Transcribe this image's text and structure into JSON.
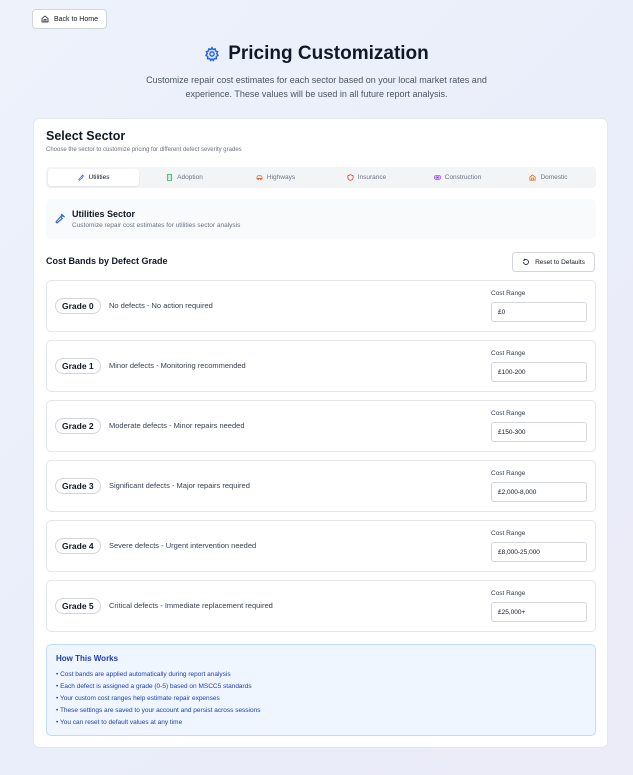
{
  "nav": {
    "back_label": "Back to Home"
  },
  "header": {
    "title": "Pricing Customization",
    "subtitle": "Customize repair cost estimates for each sector based on your local market rates and experience. These values will be used in all future report analysis."
  },
  "sector_select": {
    "title": "Select Sector",
    "description": "Choose the sector to customize pricing for different defect severity grades",
    "tabs": [
      {
        "label": "Utilities",
        "icon": "wrench-icon",
        "active": true
      },
      {
        "label": "Adoption",
        "icon": "building-icon",
        "active": false
      },
      {
        "label": "Highways",
        "icon": "car-icon",
        "active": false
      },
      {
        "label": "Insurance",
        "icon": "shield-icon",
        "active": false
      },
      {
        "label": "Construction",
        "icon": "hard-hat-icon",
        "active": false
      },
      {
        "label": "Domestic",
        "icon": "home-icon",
        "active": false
      }
    ]
  },
  "selected_sector": {
    "name": "Utilities Sector",
    "description": "Customize repair cost estimates for utilities sector analysis"
  },
  "bands": {
    "title": "Cost Bands by Defect Grade",
    "reset_label": "Reset to Defaults",
    "range_label": "Cost Range",
    "grades": [
      {
        "grade": "Grade 0",
        "description": "No defects - No action required",
        "range": "£0"
      },
      {
        "grade": "Grade 1",
        "description": "Minor defects - Monitoring recommended",
        "range": "£100-200"
      },
      {
        "grade": "Grade 2",
        "description": "Moderate defects - Minor repairs needed",
        "range": "£150-300"
      },
      {
        "grade": "Grade 3",
        "description": "Significant defects - Major repairs required",
        "range": "£2,000-8,000"
      },
      {
        "grade": "Grade 4",
        "description": "Severe defects - Urgent intervention needed",
        "range": "£8,000-25,000"
      },
      {
        "grade": "Grade 5",
        "description": "Critical defects - Immediate replacement required",
        "range": "£25,000+"
      }
    ]
  },
  "info": {
    "title": "How This Works",
    "items": [
      "• Cost bands are applied automatically during report analysis",
      "• Each defect is assigned a grade (0-5) based on MSCC5 standards",
      "• Your custom cost ranges help estimate repair expenses",
      "• These settings are saved to your account and persist across sessions",
      "• You can reset to default values at any time"
    ]
  },
  "colors": {
    "accent": "#2563eb",
    "info_bg": "#eff6ff",
    "info_text": "#1e40af",
    "adoption": "#16a34a",
    "highways": "#ea580c",
    "insurance": "#dc2626",
    "construction": "#9333ea",
    "domestic": "#ea580c"
  }
}
